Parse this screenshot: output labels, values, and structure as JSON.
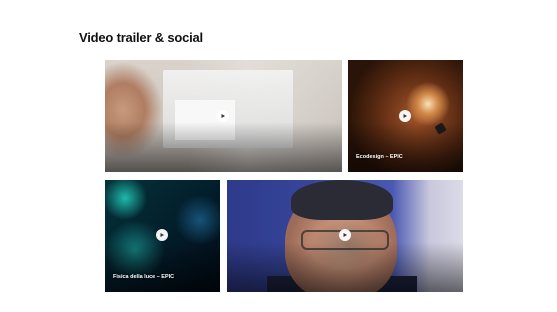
{
  "section": {
    "eyebrow": "",
    "title": "Video trailer & social"
  },
  "cards": [
    {
      "caption": "",
      "sub": ""
    },
    {
      "caption": "Ecodesign – EPIC",
      "sub": ""
    },
    {
      "caption": "Fisica della luce – EPIC",
      "sub": ""
    },
    {
      "caption": "",
      "sub": ""
    }
  ],
  "icons": {
    "play": "play-icon"
  },
  "colors": {
    "title": "#111111",
    "play_button": "#ffffff"
  }
}
